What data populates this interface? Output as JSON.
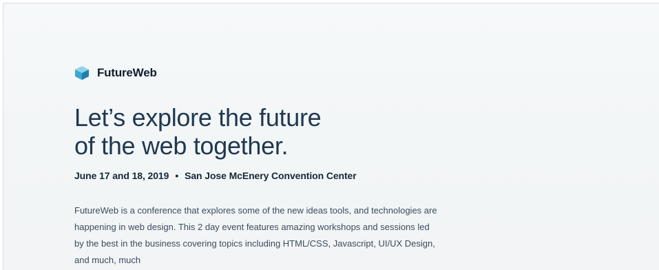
{
  "brand": {
    "name": "FutureWeb",
    "logo_icon": "cube-icon",
    "logo_colors": [
      "#4fb2d4",
      "#2c8fb8",
      "#7ccbe6"
    ]
  },
  "hero": {
    "headline_line1": "Let’s explore the future",
    "headline_line2": "of the web together.",
    "date": "June 17 and 18, 2019",
    "separator": "•",
    "venue": "San Jose McEnery Convention Center",
    "description": "FutureWeb is a conference that explores some of the new ideas tools, and technologies are happening in web design. This 2 day event features amazing workshops and sessions led by the best in the business covering topics including HTML/CSS, Javascript, UI/UX Design, and much, much"
  }
}
